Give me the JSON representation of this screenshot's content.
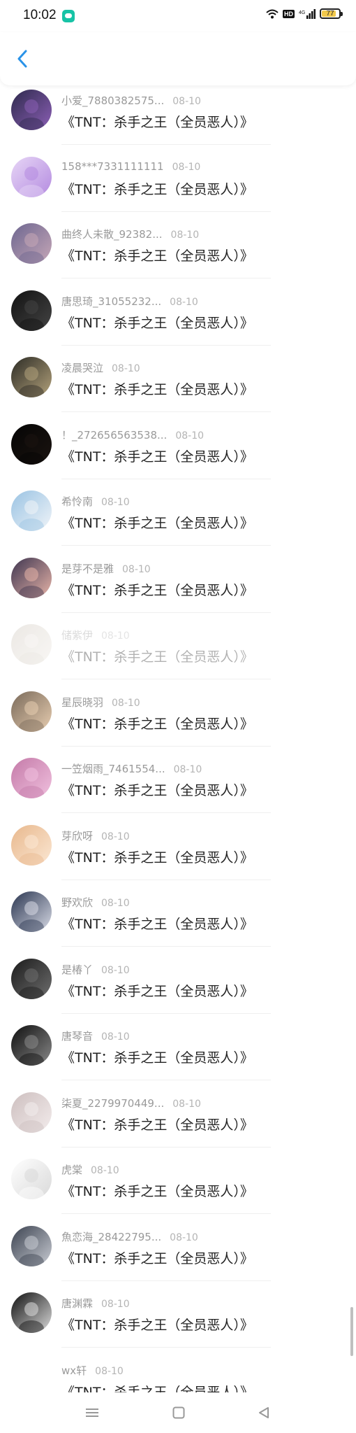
{
  "status_bar": {
    "time": "10:02",
    "battery_level": "77",
    "battery_fraction": 0.77,
    "hd_label": "HD",
    "network": "4G"
  },
  "nav": {
    "back_icon": "chevron-left-icon"
  },
  "items": [
    {
      "name": "小爱_7880382575...",
      "date": "08-10",
      "message": "《TNT：杀手之王（全员恶人）》",
      "avatar_colors": [
        "#2e2a4d",
        "#8b5fb5"
      ]
    },
    {
      "name": "158***7331111111",
      "date": "08-10",
      "message": "《TNT：杀手之王（全员恶人）》",
      "avatar_colors": [
        "#e7d6f6",
        "#b48be0"
      ]
    },
    {
      "name": "曲终人未散_92382...",
      "date": "08-10",
      "message": "《TNT：杀手之王（全员恶人）》",
      "avatar_colors": [
        "#6d6690",
        "#c6a7b7"
      ]
    },
    {
      "name": "唐思琦_31055232...",
      "date": "08-10",
      "message": "《TNT：杀手之王（全员恶人）》",
      "avatar_colors": [
        "#121212",
        "#444444"
      ]
    },
    {
      "name": "凌晨哭泣",
      "date": "08-10",
      "message": "《TNT：杀手之王（全员恶人）》",
      "avatar_colors": [
        "#2c2b25",
        "#b3a27b"
      ]
    },
    {
      "name": "！_272656563538...",
      "date": "08-10",
      "message": "《TNT：杀手之王（全员恶人）》",
      "avatar_colors": [
        "#050505",
        "#1b1410"
      ]
    },
    {
      "name": "希怜南",
      "date": "08-10",
      "message": "《TNT：杀手之王（全员恶人）》",
      "avatar_colors": [
        "#9ac3e3",
        "#f0f4f8"
      ]
    },
    {
      "name": "是芽不是雅",
      "date": "08-10",
      "message": "《TNT：杀手之王（全员恶人）》",
      "avatar_colors": [
        "#3e3550",
        "#e7b4a8"
      ]
    },
    {
      "name": "储紫伊",
      "date": "08-10",
      "message": "《TNT：杀手之王（全员恶人）》",
      "avatar_colors": [
        "#dcd6cf",
        "#f4f1ec"
      ],
      "faded": true
    },
    {
      "name": "星辰晓羽",
      "date": "08-10",
      "message": "《TNT：杀手之王（全员恶人）》",
      "avatar_colors": [
        "#7a6a5a",
        "#e7cdb0"
      ]
    },
    {
      "name": "一笠烟雨_7461554...",
      "date": "08-10",
      "message": "《TNT：杀手之王（全员恶人）》",
      "avatar_colors": [
        "#c47aa8",
        "#f0c0de"
      ]
    },
    {
      "name": "芽欣呀",
      "date": "08-10",
      "message": "《TNT：杀手之王（全员恶人）》",
      "avatar_colors": [
        "#e8b88d",
        "#fbe7d3"
      ]
    },
    {
      "name": "野欢欣",
      "date": "08-10",
      "message": "《TNT：杀手之王（全员恶人）》",
      "avatar_colors": [
        "#2a3550",
        "#d8dbe6"
      ]
    },
    {
      "name": "是椿丫",
      "date": "08-10",
      "message": "《TNT：杀手之王（全员恶人）》",
      "avatar_colors": [
        "#1b1b1b",
        "#6e6e6e"
      ]
    },
    {
      "name": "唐琴音",
      "date": "08-10",
      "message": "《TNT：杀手之王（全员恶人）》",
      "avatar_colors": [
        "#0e0e0e",
        "#8a8a8a"
      ]
    },
    {
      "name": "柒夏_2279970449...",
      "date": "08-10",
      "message": "《TNT：杀手之王（全员恶人）》",
      "avatar_colors": [
        "#cdbfbf",
        "#f3ecec"
      ]
    },
    {
      "name": "虎棠",
      "date": "08-10",
      "message": "《TNT：杀手之王（全员恶人）》",
      "avatar_colors": [
        "#ffffff",
        "#d9d9d9"
      ]
    },
    {
      "name": "魚恋海_28422795...",
      "date": "08-10",
      "message": "《TNT：杀手之王（全员恶人）》",
      "avatar_colors": [
        "#3b4250",
        "#c9ccd3"
      ]
    },
    {
      "name": "唐渊霖",
      "date": "08-10",
      "message": "《TNT：杀手之王（全员恶人）》",
      "avatar_colors": [
        "#0f0f0f",
        "#dcdcdc"
      ]
    },
    {
      "name": "wx轩",
      "date": "08-10",
      "message": "《TNT：杀手之王（全员恶人）》",
      "avatar_colors": [
        "#ffffff",
        "#ffffff"
      ],
      "no_avatar": true
    }
  ],
  "bottom_nav": {
    "menu_icon": "menu-icon",
    "home_icon": "home-square-icon",
    "back_icon": "back-triangle-icon"
  }
}
